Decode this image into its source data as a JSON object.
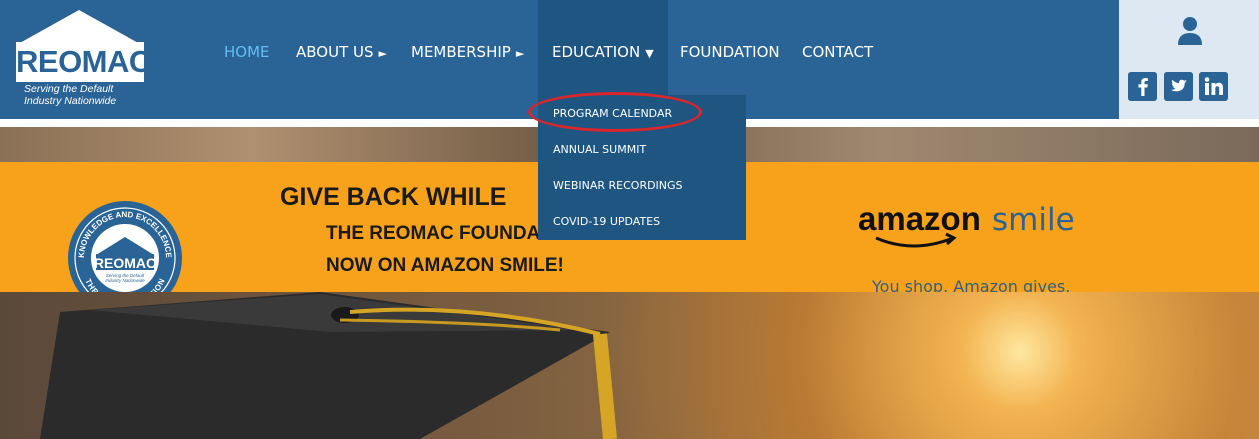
{
  "header": {
    "logo": {
      "word": "REOMAC",
      "tagline_line1": "Serving the Default",
      "tagline_line2": "Industry Nationwide"
    },
    "nav": [
      {
        "label": "HOME",
        "arrow": "",
        "state": "active"
      },
      {
        "label": "ABOUT US",
        "arrow": "►",
        "state": ""
      },
      {
        "label": "MEMBERSHIP",
        "arrow": "►",
        "state": ""
      },
      {
        "label": "EDUCATION",
        "arrow": "▼",
        "state": "open"
      },
      {
        "label": "FOUNDATION",
        "arrow": "",
        "state": ""
      },
      {
        "label": "CONTACT",
        "arrow": "",
        "state": ""
      }
    ],
    "dropdown": [
      {
        "label": "PROGRAM CALENDAR",
        "highlighted": true
      },
      {
        "label": "ANNUAL SUMMIT",
        "highlighted": false
      },
      {
        "label": "WEBINAR RECORDINGS",
        "highlighted": false
      },
      {
        "label": "COVID-19 UPDATES",
        "highlighted": false
      }
    ],
    "icons": {
      "user": "user-icon",
      "facebook": "facebook-icon",
      "twitter": "twitter-icon",
      "linkedin": "linkedin-icon"
    }
  },
  "banner": {
    "seal": {
      "top_text": "KNOWLEDGE AND EXCELLENCE",
      "bottom_text": "THROUGH EDUCATION",
      "word": "REOMAC",
      "small1": "Serving the Default",
      "small2": "Industry Nationwide"
    },
    "headline1": "GIVE BACK WHILE",
    "headline2": "THE REOMAC FOUNDATION IS",
    "headline3": "NOW ON AMAZON SMILE!",
    "amazon_word": "amazon",
    "smile_word": "smile",
    "amazon_tagline": "You shop. Amazon gives."
  },
  "colors": {
    "header_bg": "#2a6496",
    "dropdown_bg": "#1e5581",
    "active_nav": "#65bdf2",
    "banner_orange": "#f8a21c",
    "highlight_ring": "#d8262d"
  }
}
